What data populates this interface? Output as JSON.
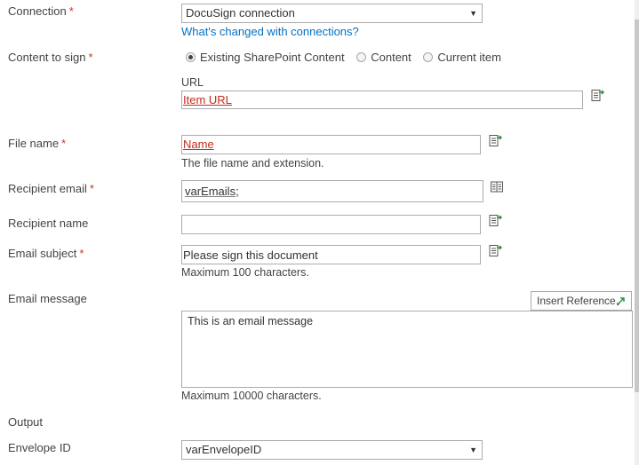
{
  "connection": {
    "label": "Connection",
    "required": "*",
    "value": "DocuSign connection",
    "changed_link": "What's changed with connections?"
  },
  "content_to_sign": {
    "label": "Content to sign",
    "required": "*",
    "options": [
      "Existing SharePoint Content",
      "Content",
      "Current item"
    ],
    "selected": "Existing SharePoint Content",
    "url_label": "URL",
    "url_value": "Item URL"
  },
  "file_name": {
    "label": "File name",
    "required": "*",
    "value": "Name",
    "hint": "The file name and extension."
  },
  "recipient_email": {
    "label": "Recipient email",
    "required": "*",
    "value": "varEmails;"
  },
  "recipient_name": {
    "label": "Recipient name",
    "value": ""
  },
  "email_subject": {
    "label": "Email subject",
    "required": "*",
    "value": "Please sign this document",
    "hint": "Maximum 100 characters."
  },
  "email_message": {
    "label": "Email message",
    "insert_reference": "Insert Reference",
    "value": "This is an email message",
    "hint": "Maximum 10000 characters."
  },
  "output": {
    "label": "Output"
  },
  "envelope_id": {
    "label": "Envelope ID",
    "value": "varEnvelopeID"
  },
  "icons": {
    "lookup": "insert-lookup-icon",
    "address_book": "address-book-icon",
    "dropdown": "dropdown-arrow-icon",
    "insert_ref": "insert-reference-icon"
  },
  "colors": {
    "link": "#0072c6",
    "reference": "#c42b1c",
    "required": "#c0392b",
    "border": "#ababab"
  }
}
